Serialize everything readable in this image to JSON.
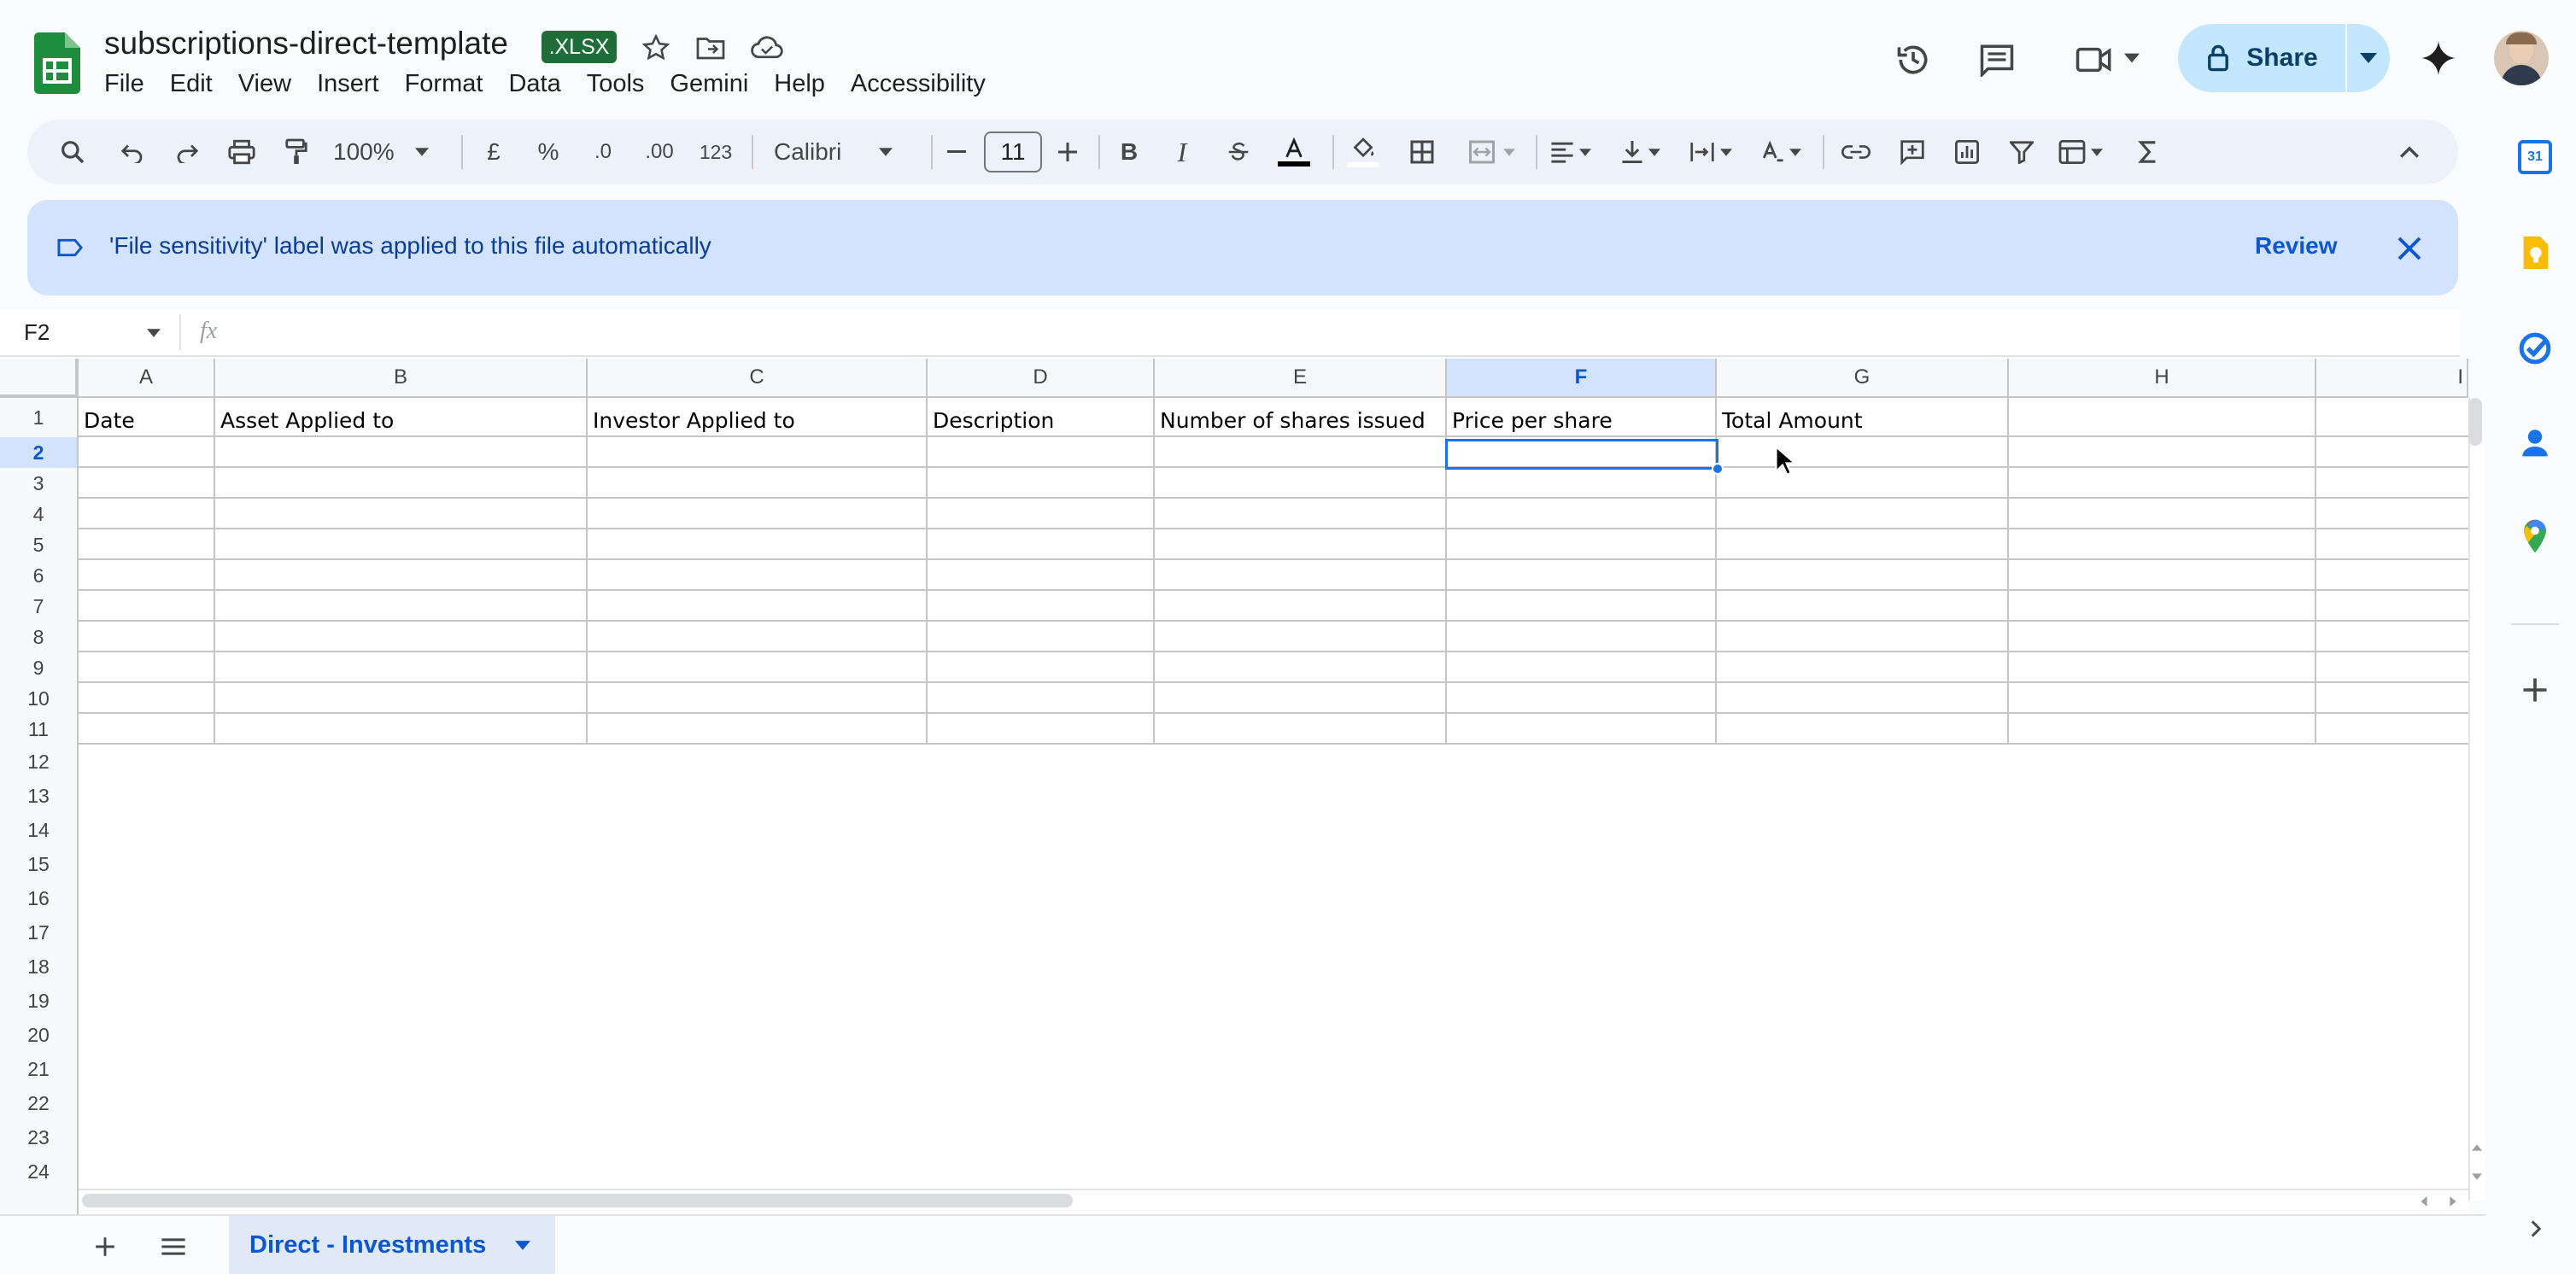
{
  "header": {
    "doc_title": "subscriptions-direct-template",
    "file_badge": ".XLSX",
    "menus": [
      "File",
      "Edit",
      "View",
      "Insert",
      "Format",
      "Data",
      "Tools",
      "Gemini",
      "Help",
      "Accessibility"
    ],
    "share_label": "Share"
  },
  "toolbar": {
    "zoom": "100%",
    "currency": "£",
    "percent": "%",
    "dec_decrease": ".0",
    "dec_increase": ".00",
    "number_format": "123",
    "font": "Calibri",
    "font_size": "11",
    "bold": "B",
    "italic": "I"
  },
  "banner": {
    "message": "'File sensitivity' label was applied to this file automatically",
    "review_label": "Review"
  },
  "formula_bar": {
    "name_box": "F2",
    "fx": "fx",
    "value": ""
  },
  "sheet": {
    "columns": [
      "A",
      "B",
      "C",
      "D",
      "E",
      "F",
      "G",
      "H",
      "I"
    ],
    "selected_column": "F",
    "rows": [
      "1",
      "2",
      "3",
      "4",
      "5",
      "6",
      "7",
      "8",
      "9",
      "10",
      "11",
      "12",
      "13",
      "14",
      "15",
      "16",
      "17",
      "18",
      "19",
      "20",
      "21",
      "22",
      "23",
      "24"
    ],
    "selected_row": "2",
    "row1": {
      "A": "Date",
      "B": "Asset Applied to",
      "C": "Investor Applied to",
      "D": "Description",
      "E": "Number of shares issued",
      "F": "Price per share",
      "G": "Total Amount"
    }
  },
  "tabs": {
    "active": "Direct - Investments"
  },
  "side_panel": {
    "calendar_day": "31"
  }
}
